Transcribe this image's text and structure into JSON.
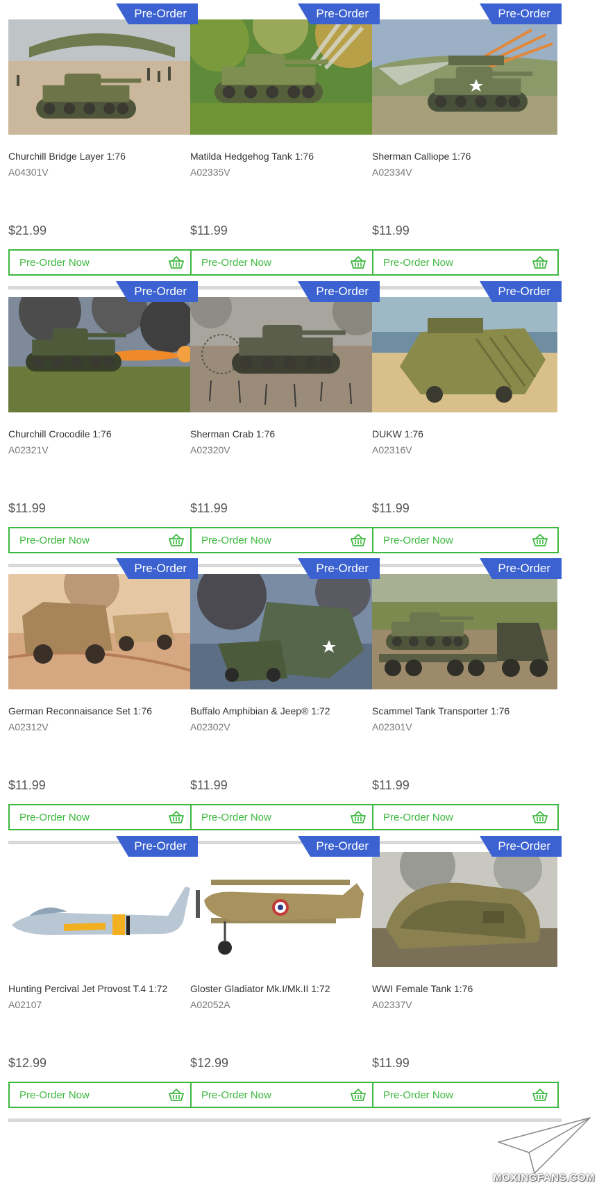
{
  "products": [
    {
      "badge": "Pre-Order",
      "title": "Churchill Bridge Layer 1:76",
      "sku": "A04301V",
      "price": "$21.99",
      "button": "Pre-Order Now",
      "image": "tank-bridge"
    },
    {
      "badge": "Pre-Order",
      "title": "Matilda Hedgehog Tank 1:76",
      "sku": "A02335V",
      "price": "$11.99",
      "button": "Pre-Order Now",
      "image": "tank-forest"
    },
    {
      "badge": "Pre-Order",
      "title": "Sherman Calliope 1:76",
      "sku": "A02334V",
      "price": "$11.99",
      "button": "Pre-Order Now",
      "image": "tank-rockets"
    },
    {
      "badge": "Pre-Order",
      "title": "Churchill Crocodile 1:76",
      "sku": "A02321V",
      "price": "$11.99",
      "button": "Pre-Order Now",
      "image": "tank-flame"
    },
    {
      "badge": "Pre-Order",
      "title": "Sherman Crab 1:76",
      "sku": "A02320V",
      "price": "$11.99",
      "button": "Pre-Order Now",
      "image": "tank-flail"
    },
    {
      "badge": "Pre-Order",
      "title": "DUKW 1:76",
      "sku": "A02316V",
      "price": "$11.99",
      "button": "Pre-Order Now",
      "image": "amphibian-beach"
    },
    {
      "badge": "Pre-Order",
      "title": "German Reconnaisance Set 1:76",
      "sku": "A02312V",
      "price": "$11.99",
      "button": "Pre-Order Now",
      "image": "desert-vehicles"
    },
    {
      "badge": "Pre-Order",
      "title": "Buffalo Amphibian & Jeep® 1:72",
      "sku": "A02302V",
      "price": "$11.99",
      "button": "Pre-Order Now",
      "image": "amphibian-jeep"
    },
    {
      "badge": "Pre-Order",
      "title": "Scammel Tank Transporter 1:76",
      "sku": "A02301V",
      "price": "$11.99",
      "button": "Pre-Order Now",
      "image": "tank-transporter"
    },
    {
      "badge": "Pre-Order",
      "title": "Hunting Percival Jet Provost T.4 1:72",
      "sku": "A02107",
      "price": "$12.99",
      "button": "Pre-Order Now",
      "image": "jet-profile"
    },
    {
      "badge": "Pre-Order",
      "title": "Gloster Gladiator Mk.I/Mk.II 1:72",
      "sku": "A02052A",
      "price": "$12.99",
      "button": "Pre-Order Now",
      "image": "biplane-profile"
    },
    {
      "badge": "Pre-Order",
      "title": "WWI Female Tank 1:76",
      "sku": "A02337V",
      "price": "$11.99",
      "button": "Pre-Order Now",
      "image": "ww1-tank"
    }
  ],
  "watermark": "MOXINGFANS.COM",
  "colors": {
    "badge": "#3b62d0",
    "button": "#3db83f",
    "divider": "#d8d8d8"
  },
  "icons": {
    "cart": "basket-icon",
    "watermark": "paper-plane-icon"
  }
}
